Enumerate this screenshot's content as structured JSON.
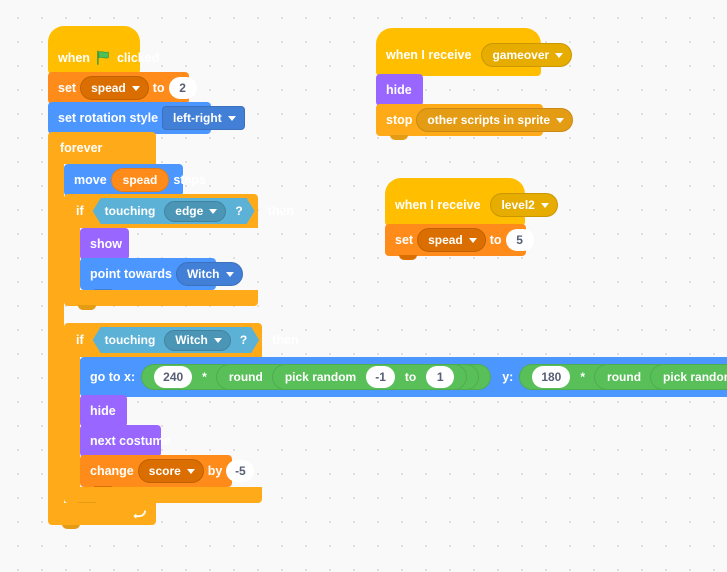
{
  "canvas": {
    "background": "#f9f9f9",
    "dot_color": "#e0e0e0"
  },
  "palette": {
    "events": "#ffbf00",
    "motion": "#4c97ff",
    "looks": "#9966ff",
    "control": "#ffab19",
    "sensing": "#5cb1d6",
    "operators": "#59c059",
    "variables": "#ff8c1a",
    "input_text": "#575e75"
  },
  "scripts": [
    {
      "id": "green-flag-script",
      "hat": {
        "prefix": "when",
        "icon": "green-flag-icon",
        "suffix": "clicked"
      },
      "set_variable": {
        "label": "set",
        "variable": "spead",
        "to_label": "to",
        "value": "2"
      },
      "set_rotation_style": {
        "label": "set rotation style",
        "style": "left-right"
      },
      "forever": {
        "label": "forever"
      },
      "move": {
        "prefix": "move",
        "variable": "spead",
        "suffix": "steps"
      },
      "if_edge": {
        "if_label": "if",
        "touching_label": "touching",
        "target": "edge",
        "question": "?",
        "then_label": "then"
      },
      "show": {
        "label": "show"
      },
      "point_towards": {
        "label": "point towards",
        "target": "Witch"
      },
      "if_witch": {
        "if_label": "if",
        "touching_label": "touching",
        "target": "Witch",
        "question": "?",
        "then_label": "then"
      },
      "go_to_xy": {
        "x_label": "go to x:",
        "y_label": "y:",
        "x_multiplier": "240",
        "y_multiplier": "180",
        "times_op": "*",
        "round_label": "round",
        "pick_random_label": "pick random",
        "random_from": "-1",
        "random_to_label": "to",
        "random_to": "1"
      },
      "hide": {
        "label": "hide"
      },
      "next_costume": {
        "label": "next costume"
      },
      "change_variable": {
        "label": "change",
        "variable": "score",
        "by_label": "by",
        "value": "-5"
      }
    },
    {
      "id": "gameover-script",
      "hat": {
        "prefix": "when I receive",
        "message": "gameover"
      },
      "hide": {
        "label": "hide"
      },
      "stop": {
        "label": "stop",
        "option": "other scripts in sprite"
      }
    },
    {
      "id": "level2-script",
      "hat": {
        "prefix": "when I receive",
        "message": "level2"
      },
      "set_variable": {
        "label": "set",
        "variable": "spead",
        "to_label": "to",
        "value": "5"
      }
    }
  ]
}
